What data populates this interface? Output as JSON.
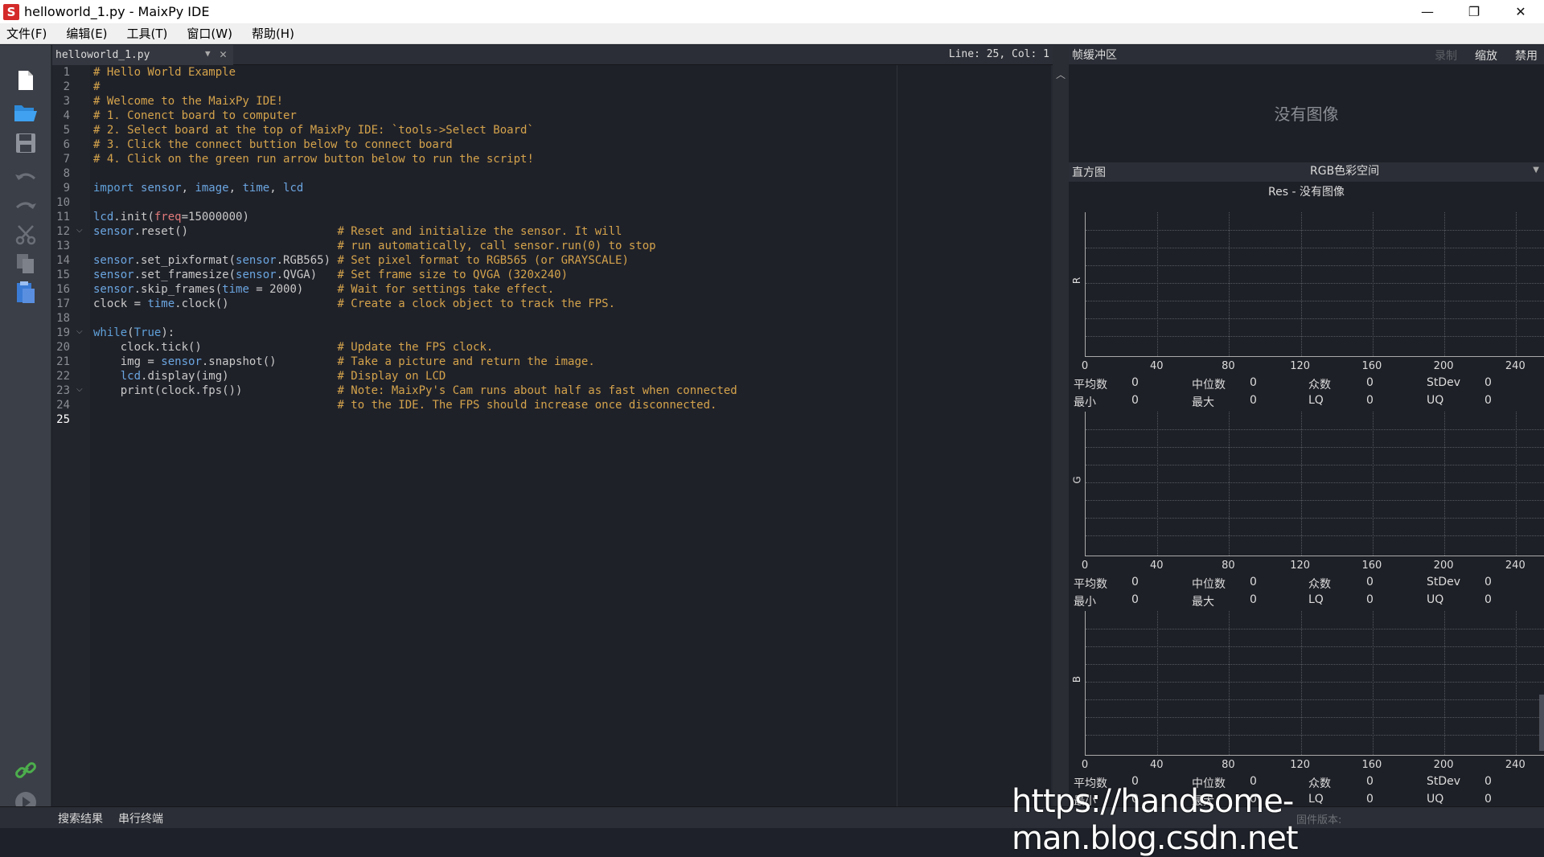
{
  "window": {
    "title": "helloworld_1.py - MaixPy IDE",
    "logo_letter": "S",
    "minimize": "—",
    "restore": "❐",
    "close": "✕"
  },
  "menu": [
    "文件(F)",
    "编辑(E)",
    "工具(T)",
    "窗口(W)",
    "帮助(H)"
  ],
  "editor": {
    "tab_name": "helloworld_1.py",
    "cursor_position": "Line: 25, Col: 1",
    "active_line": 25,
    "fold_lines": [
      12,
      19,
      23
    ],
    "lines": [
      "# Hello World Example",
      "#",
      "# Welcome to the MaixPy IDE!",
      "# 1. Conenct board to computer",
      "# 2. Select board at the top of MaixPy IDE: `tools->Select Board`",
      "# 3. Click the connect buttion below to connect board",
      "# 4. Click on the green run arrow button below to run the script!",
      "",
      "import sensor, image, time, lcd",
      "",
      "lcd.init(freq=15000000)",
      "sensor.reset()                      # Reset and initialize the sensor. It will",
      "                                    # run automatically, call sensor.run(0) to stop",
      "sensor.set_pixformat(sensor.RGB565) # Set pixel format to RGB565 (or GRAYSCALE)",
      "sensor.set_framesize(sensor.QVGA)   # Set frame size to QVGA (320x240)",
      "sensor.skip_frames(time = 2000)     # Wait for settings take effect.",
      "clock = time.clock()                # Create a clock object to track the FPS.",
      "",
      "while(True):",
      "    clock.tick()                    # Update the FPS clock.",
      "    img = sensor.snapshot()         # Take a picture and return the image.",
      "    lcd.display(img)                # Display on LCD",
      "    print(clock.fps())              # Note: MaixPy's Cam runs about half as fast when connected",
      "                                    # to the IDE. The FPS should increase once disconnected.",
      ""
    ]
  },
  "frame_buffer": {
    "title": "帧缓冲区",
    "record": "录制",
    "zoom": "缩放",
    "disable": "禁用",
    "no_image": "没有图像"
  },
  "histogram": {
    "title": "直方图",
    "color_space": "RGB色彩空间",
    "res_label": "Res - 没有图像",
    "x_ticks": [
      "0",
      "40",
      "80",
      "120",
      "160",
      "200",
      "240"
    ],
    "channels": [
      {
        "label": "R",
        "stats_row1": [
          [
            "平均数",
            "0"
          ],
          [
            "中位数",
            "0"
          ],
          [
            "众数",
            "0"
          ],
          [
            "StDev",
            "0"
          ]
        ],
        "stats_row2": [
          [
            "最小",
            "0"
          ],
          [
            "最大",
            "0"
          ],
          [
            "LQ",
            "0"
          ],
          [
            "UQ",
            "0"
          ]
        ]
      },
      {
        "label": "G",
        "stats_row1": [
          [
            "平均数",
            "0"
          ],
          [
            "中位数",
            "0"
          ],
          [
            "众数",
            "0"
          ],
          [
            "StDev",
            "0"
          ]
        ],
        "stats_row2": [
          [
            "最小",
            "0"
          ],
          [
            "最大",
            "0"
          ],
          [
            "LQ",
            "0"
          ],
          [
            "UQ",
            "0"
          ]
        ]
      },
      {
        "label": "B",
        "stats_row1": [
          [
            "平均数",
            "0"
          ],
          [
            "中位数",
            "0"
          ],
          [
            "众数",
            "0"
          ],
          [
            "StDev",
            "0"
          ]
        ],
        "stats_row2": [
          [
            "最小",
            "0"
          ],
          [
            "最大",
            "0"
          ],
          [
            "LQ",
            "0"
          ],
          [
            "UQ",
            "0"
          ]
        ]
      }
    ]
  },
  "bottom": {
    "tabs": [
      "搜索结果",
      "串行终端"
    ],
    "firmware": "固件版本:"
  },
  "watermark": "https://handsome-man.blog.csdn.net",
  "colors": {
    "comment": "#d4a34b",
    "keyword": "#5fa0d8",
    "background": "#1f2129"
  }
}
